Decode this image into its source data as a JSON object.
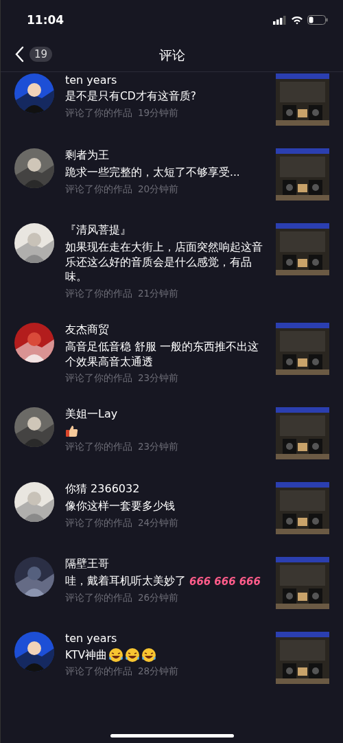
{
  "status_bar": {
    "time": "11:04"
  },
  "header": {
    "title": "评论",
    "count": "19"
  },
  "comments": [
    {
      "name": "ten years",
      "text": "是不是只有CD才有这音质?",
      "action": "评论了你的作品",
      "time": "19分钟前"
    },
    {
      "name": "剩者为王",
      "text": "跪求一些完整的，太短了不够享受...",
      "action": "评论了你的作品",
      "time": "20分钟前"
    },
    {
      "name": "『清风菩提』",
      "text": "如果现在走在大街上，店面突然响起这音乐还这么好的音质会是什么感觉，有品味。",
      "action": "评论了你的作品",
      "time": "21分钟前"
    },
    {
      "name": "友杰商贸",
      "text": "高音足低音稳 舒服 一般的东西推不出这个效果高音太通透",
      "action": "评论了你的作品",
      "time": "23分钟前"
    },
    {
      "name": "美姐一Lay",
      "emojis": [
        {
          "kind": "thumbs_up"
        }
      ],
      "action": "评论了你的作品",
      "time": "23分钟前"
    },
    {
      "name": "你猜 2366032",
      "text": "像你这样一套要多少钱",
      "action": "评论了你的作品",
      "time": "24分钟前"
    },
    {
      "name": "隔壁王哥",
      "text": "哇，戴着耳机听太美妙了",
      "stickers": [
        "666",
        "666",
        "666"
      ],
      "action": "评论了你的作品",
      "time": "26分钟前"
    },
    {
      "name": "ten years",
      "text": "KTV神曲",
      "emojis": [
        {
          "kind": "laughing"
        },
        {
          "kind": "laughing"
        },
        {
          "kind": "laughing"
        }
      ],
      "action": "评论了你的作品",
      "time": "28分钟前"
    }
  ]
}
